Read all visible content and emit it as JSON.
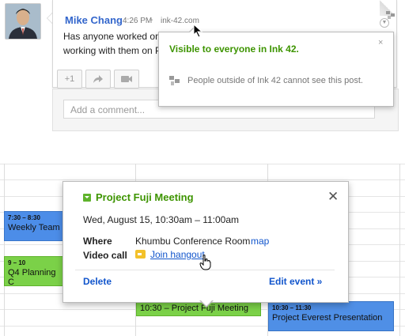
{
  "post": {
    "author": "Mike Chang",
    "time": "4:26 PM",
    "separator": "-",
    "domain": "ink-42.com",
    "line1": "Has anyone worked on",
    "line2": "working with them on P",
    "actions": {
      "plus_one": "+1",
      "share_icon": "share-arrow-icon",
      "hangout_icon": "video-camera-icon"
    },
    "comment_placeholder": "Add a comment..."
  },
  "visibility_popup": {
    "title": "Visible to everyone in Ink 42.",
    "close": "×",
    "note": "People outside of Ink 42 cannot see this post."
  },
  "calendar": {
    "events": [
      {
        "time": "7:30 – 8:30",
        "title": "Weekly Team",
        "color": "#4c8de8"
      },
      {
        "time": "9 – 10",
        "title": "Q4 Planning C",
        "color": "#7bd148"
      },
      {
        "time": "10:30 – Project Fuji Meeting",
        "title": "",
        "color": "#7bd148"
      },
      {
        "time": "10:30 – 11:30",
        "title": "Project Everest Presentation",
        "color": "#4f8fe6"
      }
    ]
  },
  "event_popup": {
    "title": "Project Fuji Meeting",
    "close": "✕",
    "date": "Wed, August 15, 10:30am – 11:00am",
    "where_label": "Where",
    "where_value": "Khumbu Conference Room",
    "map_link": "map",
    "video_label": "Video call",
    "hangout_link": "Join hangout",
    "delete": "Delete",
    "edit": "Edit event »",
    "accent_color": "#3d9400"
  }
}
